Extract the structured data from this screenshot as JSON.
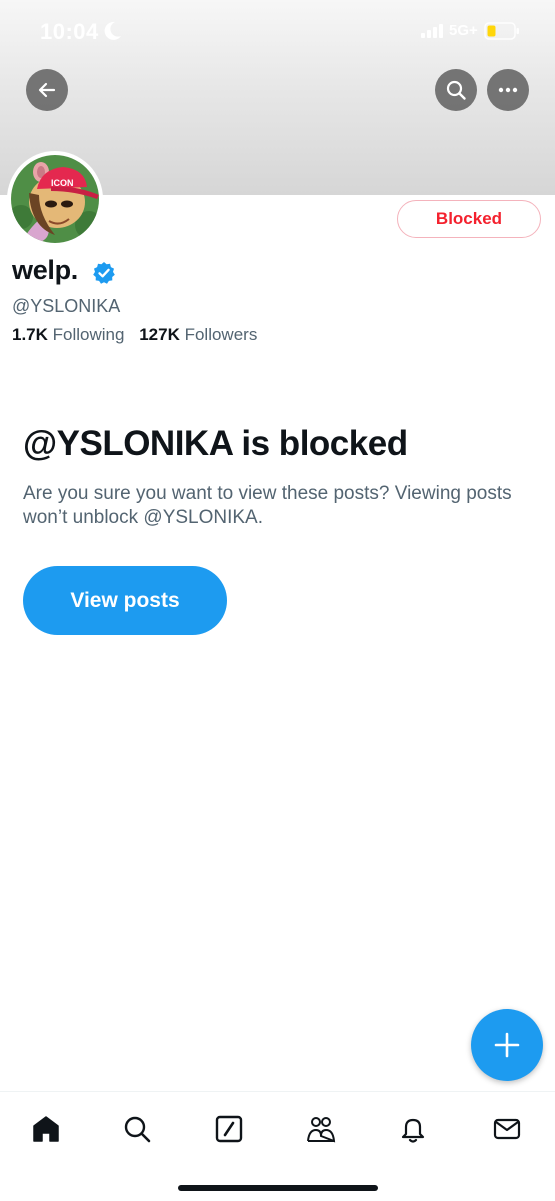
{
  "status_bar": {
    "time": "10:04",
    "network": "5G+"
  },
  "profile": {
    "display_name": "welp.",
    "handle": "@YSLONIKA",
    "following_count": "1.7K",
    "following_label": "Following",
    "followers_count": "127K",
    "followers_label": "Followers",
    "avatar_hat_text": "ICON",
    "blocked_button_label": "Blocked"
  },
  "blocked_notice": {
    "title": "@YSLONIKA is blocked",
    "description": "Are you sure you want to view these posts? Viewing posts won’t unblock @YSLONIKA.",
    "button_label": "View posts"
  },
  "colors": {
    "accent": "#1d9bf0",
    "blocked_red": "#f4212e",
    "secondary_text": "#536471"
  },
  "icons": {
    "top_bar": [
      "back-arrow-icon",
      "search-icon",
      "more-icon"
    ],
    "bottom_nav": [
      "home-icon",
      "search-icon",
      "grok-icon",
      "communities-icon",
      "notifications-icon",
      "messages-icon"
    ],
    "fab": "plus-icon"
  }
}
